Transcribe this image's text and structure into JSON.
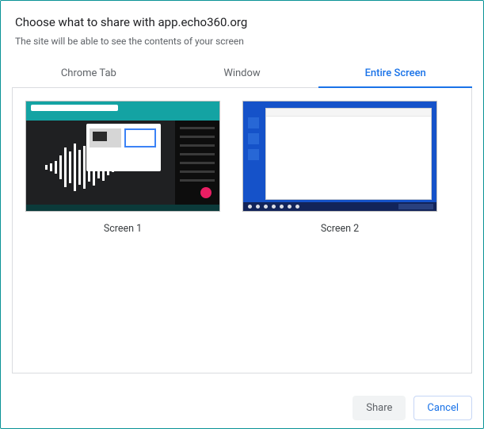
{
  "dialog": {
    "title": "Choose what to share with app.echo360.org",
    "subtitle": "The site will be able to see the contents of your screen"
  },
  "tabs": [
    {
      "label": "Chrome Tab",
      "active": false
    },
    {
      "label": "Window",
      "active": false
    },
    {
      "label": "Entire Screen",
      "active": true
    }
  ],
  "screens": [
    {
      "label": "Screen 1"
    },
    {
      "label": "Screen 2"
    }
  ],
  "footer": {
    "share_label": "Share",
    "cancel_label": "Cancel"
  }
}
